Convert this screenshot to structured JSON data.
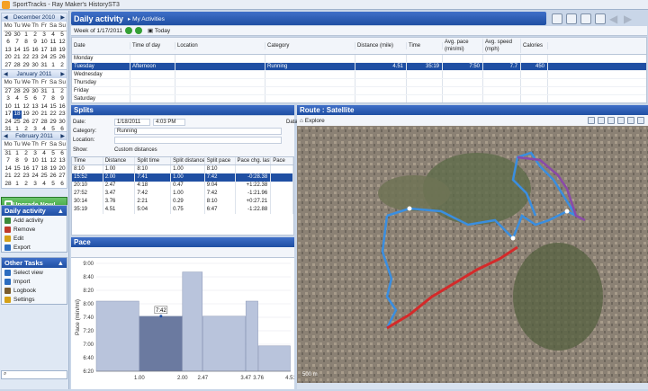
{
  "window": {
    "title": "SportTracks - Ray Maker's HistoryST3"
  },
  "calendars": [
    {
      "month": "December 2010",
      "dow": [
        "Mo",
        "Tu",
        "We",
        "Th",
        "Fr",
        "Sa",
        "Su"
      ],
      "days": [
        "29",
        "30",
        "1",
        "2",
        "3",
        "4",
        "5",
        "6",
        "7",
        "8",
        "9",
        "10",
        "11",
        "12",
        "13",
        "14",
        "15",
        "16",
        "17",
        "18",
        "19",
        "20",
        "21",
        "22",
        "23",
        "24",
        "25",
        "26",
        "27",
        "28",
        "29",
        "30",
        "31",
        "1",
        "2"
      ]
    },
    {
      "month": "January 2011",
      "dow": [
        "Mo",
        "Tu",
        "We",
        "Th",
        "Fr",
        "Sa",
        "Su"
      ],
      "days": [
        "27",
        "28",
        "29",
        "30",
        "31",
        "1",
        "2",
        "3",
        "4",
        "5",
        "6",
        "7",
        "8",
        "9",
        "10",
        "11",
        "12",
        "13",
        "14",
        "15",
        "16",
        "17",
        "18",
        "19",
        "20",
        "21",
        "22",
        "23",
        "24",
        "25",
        "26",
        "27",
        "28",
        "29",
        "30",
        "31",
        "1",
        "2",
        "3",
        "4",
        "5",
        "6"
      ],
      "selected": "18"
    },
    {
      "month": "February 2011",
      "dow": [
        "Mo",
        "Tu",
        "We",
        "Th",
        "Fr",
        "Sa",
        "Su"
      ],
      "days": [
        "31",
        "1",
        "2",
        "3",
        "4",
        "5",
        "6",
        "7",
        "8",
        "9",
        "10",
        "11",
        "12",
        "13",
        "14",
        "15",
        "16",
        "17",
        "18",
        "19",
        "20",
        "21",
        "22",
        "23",
        "24",
        "25",
        "26",
        "27",
        "28",
        "1",
        "2",
        "3",
        "4",
        "5",
        "6"
      ]
    }
  ],
  "upgrade_label": "Upgrade Now!",
  "daily_tasks": {
    "title": "Daily activity",
    "items": [
      {
        "label": "Add activity",
        "icon": "add-icon",
        "color": "#3a8a3a"
      },
      {
        "label": "Remove",
        "icon": "remove-icon",
        "color": "#c0392b"
      },
      {
        "label": "Edit",
        "icon": "edit-icon",
        "color": "#d4a017"
      },
      {
        "label": "Export",
        "icon": "export-icon",
        "color": "#2b6cc0"
      }
    ]
  },
  "other_tasks": {
    "title": "Other Tasks",
    "items": [
      {
        "label": "Select view",
        "icon": "view-icon",
        "color": "#2b6cc0"
      },
      {
        "label": "Import",
        "icon": "import-icon",
        "color": "#2b6cc0"
      },
      {
        "label": "Logbook",
        "icon": "logbook-icon",
        "color": "#7a5c2e"
      },
      {
        "label": "Settings",
        "icon": "settings-icon",
        "color": "#d4a017"
      }
    ]
  },
  "main": {
    "title": "Daily activity",
    "view_menu": "My Activities",
    "week_label": "Week of 1/17/2011",
    "today_label": "Today",
    "columns": [
      "Date",
      "Time of day",
      "Location",
      "Category",
      "Distance (mile)",
      "Time",
      "Avg. pace (min/mi)",
      "Avg. speed (mph)",
      "Calories"
    ],
    "days": [
      {
        "date": "Monday"
      },
      {
        "date": "Tuesday",
        "time": "Afternoon",
        "location": "",
        "category": "Running",
        "distance": "4.51",
        "duration": "35:19",
        "pace": "7:50",
        "speed": "7.7",
        "calories": "450",
        "selected": true
      },
      {
        "date": "Wednesday"
      },
      {
        "date": "Thursday"
      },
      {
        "date": "Friday"
      },
      {
        "date": "Saturday"
      },
      {
        "date": "Sunday"
      }
    ]
  },
  "splits": {
    "title": "Splits",
    "date_label": "Date:",
    "date_value": "1/18/2011",
    "time_value": "4:03 PM",
    "data_label": "Data",
    "category_label": "Category:",
    "category_value": "Running",
    "location_label": "Location:",
    "show_label": "Show:",
    "show_value": "Custom distances",
    "columns": [
      "Time",
      "Distance",
      "Split time",
      "Split distance",
      "Split pace",
      "Pace chg. last",
      "Pace"
    ],
    "rows": [
      [
        "8:10",
        "1.00",
        "8:10",
        "1.00",
        "8:10",
        "",
        ""
      ],
      [
        "15:52",
        "2.00",
        "7:41",
        "1.00",
        "7:42",
        "-0:28.38",
        ""
      ],
      [
        "20:10",
        "2.47",
        "4:18",
        "0.47",
        "9:04",
        "+1:22.38",
        ""
      ],
      [
        "27:52",
        "3.47",
        "7:42",
        "1.00",
        "7:42",
        "-1:21.96",
        ""
      ],
      [
        "30:14",
        "3.76",
        "2:21",
        "0.29",
        "8:10",
        "+0:27.21",
        ""
      ],
      [
        "35:19",
        "4.51",
        "5:04",
        "0.75",
        "6:47",
        "-1:22.88",
        ""
      ]
    ],
    "selected_row": 1
  },
  "pace": {
    "title": "Pace",
    "tooltip": "7:42"
  },
  "chart_data": {
    "type": "bar",
    "title": "Pace",
    "ylabel": "Pace (min/mi)",
    "x_ticks": [
      "1.00",
      "2.00",
      "2.47",
      "3.47",
      "3.76",
      "4.51"
    ],
    "y_ticks": [
      "9:00",
      "8:40",
      "8:20",
      "8:00",
      "7:40",
      "7:20",
      "7:00",
      "6:40",
      "6:20"
    ],
    "ylim_seconds": [
      360,
      560
    ],
    "bars": [
      {
        "from": 0.0,
        "to": 1.0,
        "pace": "8:10",
        "seconds": 490
      },
      {
        "from": 1.0,
        "to": 2.0,
        "pace": "7:42",
        "seconds": 462,
        "highlighted": true
      },
      {
        "from": 2.0,
        "to": 2.47,
        "pace": "9:04",
        "seconds": 544
      },
      {
        "from": 2.47,
        "to": 3.47,
        "pace": "7:42",
        "seconds": 462
      },
      {
        "from": 3.47,
        "to": 3.76,
        "pace": "8:10",
        "seconds": 490
      },
      {
        "from": 3.76,
        "to": 4.51,
        "pace": "6:47",
        "seconds": 407
      }
    ],
    "xlim": [
      0,
      4.51
    ],
    "grid": true
  },
  "route": {
    "title": "Route : Satellite",
    "explore_label": "Explore",
    "scale_label": "500 m"
  }
}
